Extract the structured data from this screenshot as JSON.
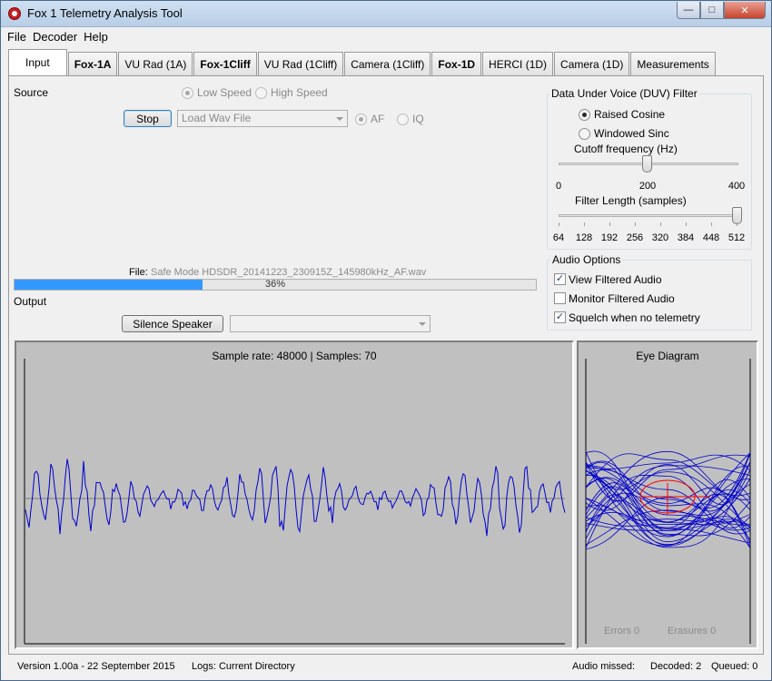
{
  "window": {
    "title": "Fox 1 Telemetry Analysis Tool",
    "min": "—",
    "max": "□",
    "close": "✕"
  },
  "menu": [
    "File",
    "Decoder",
    "Help"
  ],
  "tabs": [
    {
      "label": "Input",
      "bold": false,
      "active": true
    },
    {
      "label": "Fox-1A",
      "bold": true,
      "active": false
    },
    {
      "label": "VU Rad (1A)",
      "bold": false,
      "active": false
    },
    {
      "label": "Fox-1Cliff",
      "bold": true,
      "active": false
    },
    {
      "label": "VU Rad (1Cliff)",
      "bold": false,
      "active": false
    },
    {
      "label": "Camera (1Cliff)",
      "bold": false,
      "active": false
    },
    {
      "label": "Fox-1D",
      "bold": true,
      "active": false
    },
    {
      "label": "HERCI (1D)",
      "bold": false,
      "active": false
    },
    {
      "label": "Camera (1D)",
      "bold": false,
      "active": false
    },
    {
      "label": "Measurements",
      "bold": false,
      "active": false
    }
  ],
  "source": {
    "label": "Source",
    "low_speed": "Low Speed",
    "high_speed": "High Speed",
    "stop_button": "Stop",
    "combo_value": "Load Wav File",
    "af": "AF",
    "iq": "IQ"
  },
  "file": {
    "label": "File:",
    "name": "Safe Mode HDSDR_20141223_230915Z_145980kHz_AF.wav",
    "progress_pct": 36,
    "progress_text": "36%"
  },
  "output": {
    "label": "Output",
    "silence_button": "Silence Speaker"
  },
  "duv": {
    "title": "Data Under Voice (DUV) Filter",
    "raised_cosine": "Raised Cosine",
    "windowed_sinc": "Windowed Sinc",
    "cutoff_label": "Cutoff frequency (Hz)",
    "cutoff_ticks": [
      "0",
      "200",
      "400"
    ],
    "cutoff_value": 200,
    "cutoff_max": 400,
    "length_label": "Filter Length (samples)",
    "length_ticks": [
      "64",
      "128",
      "192",
      "256",
      "320",
      "384",
      "448",
      "512"
    ],
    "length_value_index": 7
  },
  "audio": {
    "title": "Audio Options",
    "view_filtered": "View Filtered Audio",
    "monitor_filtered": "Monitor Filtered Audio",
    "squelch": "Squelch when no telemetry"
  },
  "scope": {
    "caption": "Sample rate: 48000 | Samples: 70"
  },
  "eye": {
    "title": "Eye Diagram",
    "errors": "Errors  0",
    "erasures": "Erasures  0"
  },
  "status": {
    "version": "Version 1.00a - 22 September 2015",
    "logs": "Logs: Current Directory",
    "audio_missed": "Audio missed:",
    "decoded": "Decoded: 2",
    "queued": "Queued: 0"
  },
  "colors": {
    "trace": "#0000cc",
    "eye_marker": "#ff0000",
    "plot_bg": "#c0c0c0",
    "progress": "#3399ff"
  }
}
